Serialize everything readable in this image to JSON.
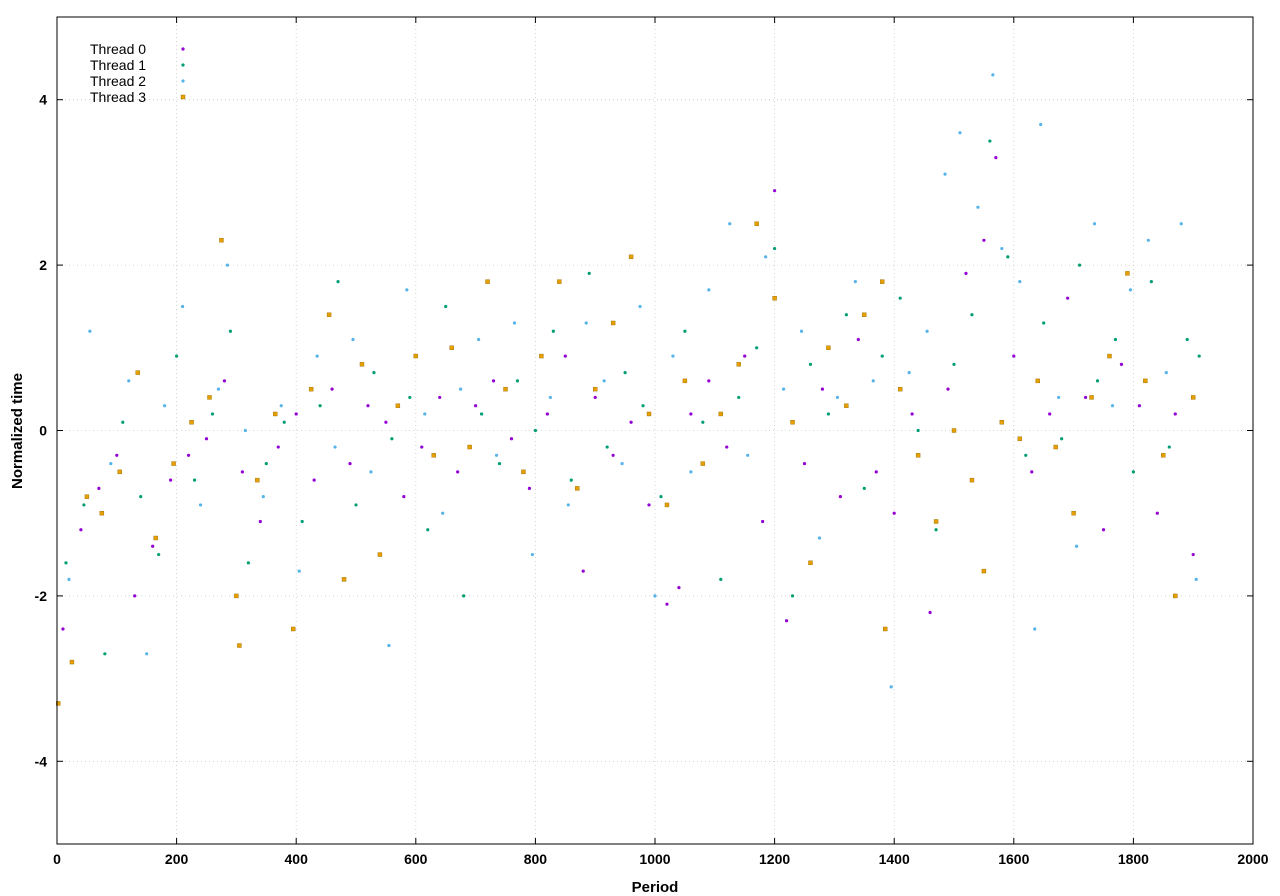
{
  "chart_data": {
    "type": "scatter",
    "title": "",
    "xlabel": "Period",
    "ylabel": "Normalized time",
    "xlim": [
      0,
      2000
    ],
    "ylim": [
      -5,
      5
    ],
    "xticks": [
      0,
      200,
      400,
      600,
      800,
      1000,
      1200,
      1400,
      1600,
      1800,
      2000
    ],
    "yticks": [
      -4,
      -2,
      0,
      2,
      4
    ],
    "grid": true,
    "legend_position": "top-left",
    "series": [
      {
        "name": "Thread 0",
        "color": "#9400d3",
        "marker": "dot",
        "points": [
          [
            10,
            -2.4
          ],
          [
            40,
            -1.2
          ],
          [
            70,
            -0.7
          ],
          [
            100,
            -0.3
          ],
          [
            130,
            -2.0
          ],
          [
            160,
            -1.4
          ],
          [
            190,
            -0.6
          ],
          [
            220,
            -0.3
          ],
          [
            250,
            -0.1
          ],
          [
            280,
            0.6
          ],
          [
            310,
            -0.5
          ],
          [
            340,
            -1.1
          ],
          [
            370,
            -0.2
          ],
          [
            400,
            0.2
          ],
          [
            430,
            -0.6
          ],
          [
            460,
            0.5
          ],
          [
            490,
            -0.4
          ],
          [
            520,
            0.3
          ],
          [
            550,
            0.1
          ],
          [
            580,
            -0.8
          ],
          [
            610,
            -0.2
          ],
          [
            640,
            0.4
          ],
          [
            670,
            -0.5
          ],
          [
            700,
            0.3
          ],
          [
            730,
            0.6
          ],
          [
            760,
            -0.1
          ],
          [
            790,
            -0.7
          ],
          [
            820,
            0.2
          ],
          [
            850,
            0.9
          ],
          [
            880,
            -1.7
          ],
          [
            900,
            0.4
          ],
          [
            930,
            -0.3
          ],
          [
            960,
            0.1
          ],
          [
            990,
            -0.9
          ],
          [
            1020,
            -2.1
          ],
          [
            1040,
            -1.9
          ],
          [
            1060,
            0.2
          ],
          [
            1090,
            0.6
          ],
          [
            1120,
            -0.2
          ],
          [
            1150,
            0.9
          ],
          [
            1180,
            -1.1
          ],
          [
            1200,
            2.9
          ],
          [
            1220,
            -2.3
          ],
          [
            1250,
            -0.4
          ],
          [
            1280,
            0.5
          ],
          [
            1310,
            -0.8
          ],
          [
            1340,
            1.1
          ],
          [
            1370,
            -0.5
          ],
          [
            1400,
            -1.0
          ],
          [
            1430,
            0.2
          ],
          [
            1460,
            -2.2
          ],
          [
            1490,
            0.5
          ],
          [
            1520,
            1.9
          ],
          [
            1550,
            2.3
          ],
          [
            1570,
            3.3
          ],
          [
            1600,
            0.9
          ],
          [
            1630,
            -0.5
          ],
          [
            1660,
            0.2
          ],
          [
            1690,
            1.6
          ],
          [
            1720,
            0.4
          ],
          [
            1750,
            -1.2
          ],
          [
            1780,
            0.8
          ],
          [
            1810,
            0.3
          ],
          [
            1840,
            -1.0
          ],
          [
            1870,
            0.2
          ],
          [
            1900,
            -1.5
          ]
        ]
      },
      {
        "name": "Thread 1",
        "color": "#009e73",
        "marker": "dot",
        "points": [
          [
            15,
            -1.6
          ],
          [
            45,
            -0.9
          ],
          [
            80,
            -2.7
          ],
          [
            110,
            0.1
          ],
          [
            140,
            -0.8
          ],
          [
            170,
            -1.5
          ],
          [
            200,
            0.9
          ],
          [
            230,
            -0.6
          ],
          [
            260,
            0.2
          ],
          [
            290,
            1.2
          ],
          [
            320,
            -1.6
          ],
          [
            350,
            -0.4
          ],
          [
            380,
            0.1
          ],
          [
            410,
            -1.1
          ],
          [
            440,
            0.3
          ],
          [
            470,
            1.8
          ],
          [
            500,
            -0.9
          ],
          [
            530,
            0.7
          ],
          [
            560,
            -0.1
          ],
          [
            590,
            0.4
          ],
          [
            620,
            -1.2
          ],
          [
            650,
            1.5
          ],
          [
            680,
            -2.0
          ],
          [
            710,
            0.2
          ],
          [
            740,
            -0.4
          ],
          [
            770,
            0.6
          ],
          [
            800,
            0.0
          ],
          [
            830,
            1.2
          ],
          [
            860,
            -0.6
          ],
          [
            890,
            1.9
          ],
          [
            920,
            -0.2
          ],
          [
            950,
            0.7
          ],
          [
            980,
            0.3
          ],
          [
            1010,
            -0.8
          ],
          [
            1050,
            1.2
          ],
          [
            1080,
            0.1
          ],
          [
            1110,
            -1.8
          ],
          [
            1140,
            0.4
          ],
          [
            1170,
            1.0
          ],
          [
            1200,
            2.2
          ],
          [
            1230,
            -2.0
          ],
          [
            1260,
            0.8
          ],
          [
            1290,
            0.2
          ],
          [
            1320,
            1.4
          ],
          [
            1350,
            -0.7
          ],
          [
            1380,
            0.9
          ],
          [
            1410,
            1.6
          ],
          [
            1440,
            0.0
          ],
          [
            1470,
            -1.2
          ],
          [
            1500,
            0.8
          ],
          [
            1530,
            1.4
          ],
          [
            1560,
            3.5
          ],
          [
            1590,
            2.1
          ],
          [
            1620,
            -0.3
          ],
          [
            1650,
            1.3
          ],
          [
            1680,
            -0.1
          ],
          [
            1710,
            2.0
          ],
          [
            1740,
            0.6
          ],
          [
            1770,
            1.1
          ],
          [
            1800,
            -0.5
          ],
          [
            1830,
            1.8
          ],
          [
            1860,
            -0.2
          ],
          [
            1890,
            1.1
          ],
          [
            1910,
            0.9
          ]
        ]
      },
      {
        "name": "Thread 2",
        "color": "#56b4e9",
        "marker": "dot",
        "points": [
          [
            20,
            -1.8
          ],
          [
            55,
            1.2
          ],
          [
            90,
            -0.4
          ],
          [
            120,
            0.6
          ],
          [
            150,
            -2.7
          ],
          [
            180,
            0.3
          ],
          [
            210,
            1.5
          ],
          [
            240,
            -0.9
          ],
          [
            270,
            0.5
          ],
          [
            285,
            2.0
          ],
          [
            315,
            0.0
          ],
          [
            345,
            -0.8
          ],
          [
            375,
            0.3
          ],
          [
            405,
            -1.7
          ],
          [
            435,
            0.9
          ],
          [
            465,
            -0.2
          ],
          [
            495,
            1.1
          ],
          [
            525,
            -0.5
          ],
          [
            555,
            -2.6
          ],
          [
            585,
            1.7
          ],
          [
            615,
            0.2
          ],
          [
            645,
            -1.0
          ],
          [
            675,
            0.5
          ],
          [
            705,
            1.1
          ],
          [
            735,
            -0.3
          ],
          [
            765,
            1.3
          ],
          [
            795,
            -1.5
          ],
          [
            825,
            0.4
          ],
          [
            855,
            -0.9
          ],
          [
            885,
            1.3
          ],
          [
            915,
            0.6
          ],
          [
            945,
            -0.4
          ],
          [
            975,
            1.5
          ],
          [
            1000,
            -2.0
          ],
          [
            1030,
            0.9
          ],
          [
            1060,
            -0.5
          ],
          [
            1090,
            1.7
          ],
          [
            1125,
            2.5
          ],
          [
            1155,
            -0.3
          ],
          [
            1185,
            2.1
          ],
          [
            1215,
            0.5
          ],
          [
            1245,
            1.2
          ],
          [
            1275,
            -1.3
          ],
          [
            1305,
            0.4
          ],
          [
            1335,
            1.8
          ],
          [
            1365,
            0.6
          ],
          [
            1395,
            -3.1
          ],
          [
            1425,
            0.7
          ],
          [
            1455,
            1.2
          ],
          [
            1485,
            3.1
          ],
          [
            1510,
            3.6
          ],
          [
            1540,
            2.7
          ],
          [
            1565,
            4.3
          ],
          [
            1580,
            2.2
          ],
          [
            1610,
            1.8
          ],
          [
            1635,
            -2.4
          ],
          [
            1645,
            3.7
          ],
          [
            1675,
            0.4
          ],
          [
            1705,
            -1.4
          ],
          [
            1735,
            2.5
          ],
          [
            1765,
            0.3
          ],
          [
            1795,
            1.7
          ],
          [
            1825,
            2.3
          ],
          [
            1855,
            0.7
          ],
          [
            1880,
            2.5
          ],
          [
            1905,
            -1.8
          ]
        ]
      },
      {
        "name": "Thread 3",
        "color": "#e69f00",
        "marker": "square",
        "points": [
          [
            2,
            -3.3
          ],
          [
            25,
            -2.8
          ],
          [
            50,
            -0.8
          ],
          [
            75,
            -1.0
          ],
          [
            105,
            -0.5
          ],
          [
            135,
            0.7
          ],
          [
            165,
            -1.3
          ],
          [
            195,
            -0.4
          ],
          [
            225,
            0.1
          ],
          [
            255,
            0.4
          ],
          [
            275,
            2.3
          ],
          [
            300,
            -2.0
          ],
          [
            305,
            -2.6
          ],
          [
            335,
            -0.6
          ],
          [
            365,
            0.2
          ],
          [
            395,
            -2.4
          ],
          [
            425,
            0.5
          ],
          [
            455,
            1.4
          ],
          [
            480,
            -1.8
          ],
          [
            510,
            0.8
          ],
          [
            540,
            -1.5
          ],
          [
            570,
            0.3
          ],
          [
            600,
            0.9
          ],
          [
            630,
            -0.3
          ],
          [
            660,
            1.0
          ],
          [
            690,
            -0.2
          ],
          [
            720,
            1.8
          ],
          [
            750,
            0.5
          ],
          [
            780,
            -0.5
          ],
          [
            810,
            0.9
          ],
          [
            840,
            1.8
          ],
          [
            870,
            -0.7
          ],
          [
            900,
            0.5
          ],
          [
            930,
            1.3
          ],
          [
            960,
            2.1
          ],
          [
            990,
            0.2
          ],
          [
            1020,
            -0.9
          ],
          [
            1050,
            0.6
          ],
          [
            1080,
            -0.4
          ],
          [
            1110,
            0.2
          ],
          [
            1140,
            0.8
          ],
          [
            1170,
            2.5
          ],
          [
            1200,
            1.6
          ],
          [
            1230,
            0.1
          ],
          [
            1260,
            -1.6
          ],
          [
            1290,
            1.0
          ],
          [
            1320,
            0.3
          ],
          [
            1350,
            1.4
          ],
          [
            1380,
            1.8
          ],
          [
            1385,
            -2.4
          ],
          [
            1410,
            0.5
          ],
          [
            1440,
            -0.3
          ],
          [
            1470,
            -1.1
          ],
          [
            1500,
            0.0
          ],
          [
            1530,
            -0.6
          ],
          [
            1550,
            -1.7
          ],
          [
            1580,
            0.1
          ],
          [
            1610,
            -0.1
          ],
          [
            1640,
            0.6
          ],
          [
            1670,
            -0.2
          ],
          [
            1700,
            -1.0
          ],
          [
            1730,
            0.4
          ],
          [
            1760,
            0.9
          ],
          [
            1790,
            1.9
          ],
          [
            1820,
            0.6
          ],
          [
            1850,
            -0.3
          ],
          [
            1870,
            -2.0
          ],
          [
            1900,
            0.4
          ]
        ]
      }
    ]
  }
}
